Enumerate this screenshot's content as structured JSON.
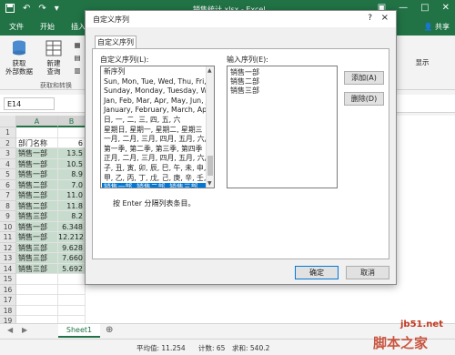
{
  "window": {
    "title": "销售统计.xlsx - Excel",
    "share_label": "共享"
  },
  "ribbon_tabs": [
    "文件",
    "开始",
    "插入"
  ],
  "ribbon": {
    "new_external_data": "获取\n外部数据",
    "new_query": "新建\n查询",
    "group_get_transform": "获取和转换",
    "show_detail": "显示"
  },
  "name_box": "E14",
  "sheet": {
    "columns": [
      "A",
      "B"
    ],
    "header_row": [
      "部门名称",
      "6"
    ],
    "rows": [
      {
        "dept": "销售一部",
        "val": "13.5"
      },
      {
        "dept": "销售一部",
        "val": "10.5"
      },
      {
        "dept": "销售一部",
        "val": "8.9"
      },
      {
        "dept": "销售二部",
        "val": "7.0"
      },
      {
        "dept": "销售二部",
        "val": "11.0"
      },
      {
        "dept": "销售二部",
        "val": "11.8"
      },
      {
        "dept": "销售三部",
        "val": "8.2"
      },
      {
        "dept": "销售一部",
        "val": "6.348"
      },
      {
        "dept": "销售一部",
        "val": "12.212"
      },
      {
        "dept": "销售三部",
        "val": "9.628"
      },
      {
        "dept": "销售三部",
        "val": "7.660"
      },
      {
        "dept": "销售三部",
        "val": "5.692"
      }
    ],
    "row_numbers": [
      "1",
      "2",
      "3",
      "4",
      "5",
      "6",
      "7",
      "8",
      "9",
      "10",
      "11",
      "12",
      "13",
      "14",
      "15",
      "16",
      "17",
      "18",
      "19"
    ],
    "tab_name": "Sheet1"
  },
  "statusbar": {
    "average": "平均值: 11.254",
    "count": "计数: 65",
    "sum": "求和: 540.2"
  },
  "dialog": {
    "title": "自定义序列",
    "help": "?",
    "close": "×",
    "tab_label": "自定义序列",
    "list_label": "自定义序列(L):",
    "entries_label": "输入序列(E):",
    "list_items": [
      "新序列",
      "Sun, Mon, Tue, Wed, Thu, Fri, S",
      "Sunday, Monday, Tuesday, Wed",
      "Jan, Feb, Mar, Apr, May, Jun, J",
      "January, February, March, April,",
      "日, 一, 二, 三, 四, 五, 六",
      "星期日, 星期一, 星期二, 星期三",
      "一月, 二月, 三月, 四月, 五月, 六月",
      "第一季, 第二季, 第三季, 第四季",
      "正月, 二月, 三月, 四月, 五月, 六月",
      "子, 丑, 寅, 卯, 辰, 巳, 午, 未, 申, 酉",
      "甲, 乙, 丙, 丁, 戊, 己, 庚, 辛, 壬, 癸",
      "销售一部, 销售二部, 销售三部"
    ],
    "selected_index": 12,
    "entries": [
      "销售一部",
      "销售二部",
      "销售三部"
    ],
    "add_button": "添加(A)",
    "delete_button": "删除(D)",
    "hint": "按 Enter 分隔列表条目。",
    "ok_button": "确定",
    "cancel_button": "取消"
  },
  "watermark": {
    "site": "jb51.net",
    "brand": "脚本之家"
  },
  "colors": {
    "excel_green": "#217346",
    "selection_blue": "#0078d7"
  }
}
